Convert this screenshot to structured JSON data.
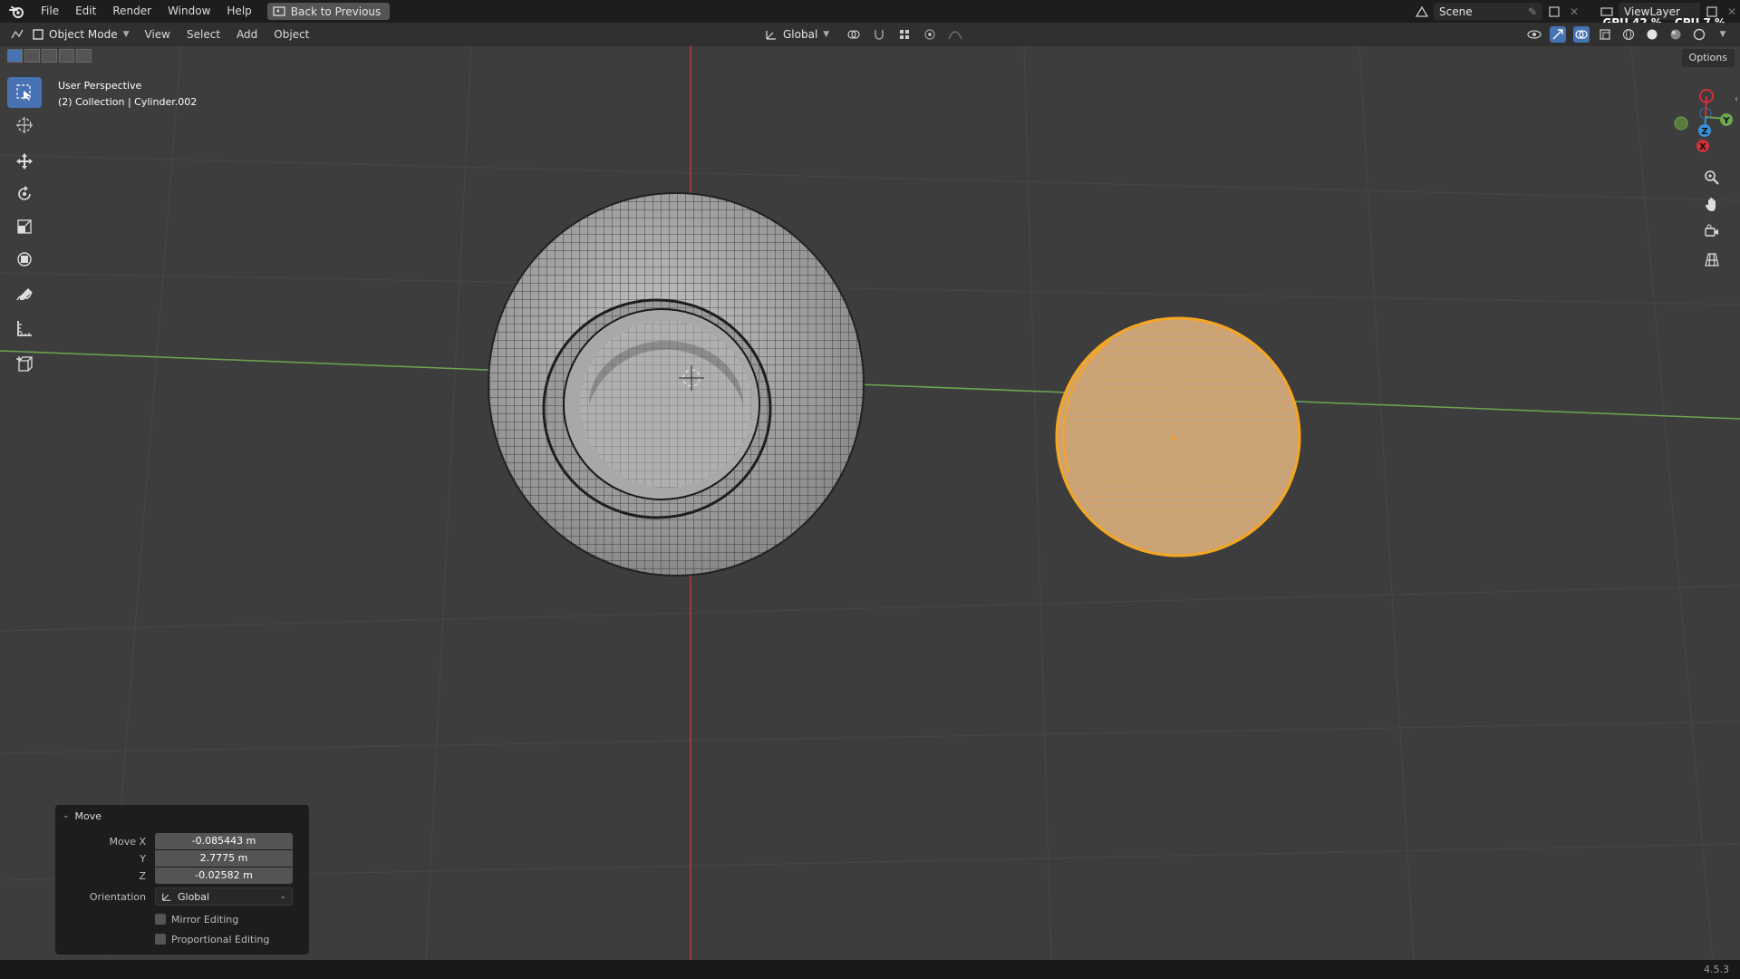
{
  "menu": {
    "items": [
      "File",
      "Edit",
      "Render",
      "Window",
      "Help"
    ],
    "back_label": "Back to Previous"
  },
  "topright": {
    "scene": "Scene",
    "viewlayer": "ViewLayer",
    "gpu": "GPU 42 %",
    "cpu": "CPU 7 %"
  },
  "header": {
    "mode": "Object Mode",
    "items": [
      "View",
      "Select",
      "Add",
      "Object"
    ],
    "orientation": "Global"
  },
  "viewport": {
    "options_label": "Options",
    "perspective": "User Perspective",
    "collection": "(2) Collection | Cylinder.002"
  },
  "gizmo": {
    "y_label": "Y",
    "z_label": "Z",
    "x_label": "X"
  },
  "move_panel": {
    "title": "Move",
    "move_x_label": "Move X",
    "move_x": "-0.085443 m",
    "y_label": "Y",
    "y": "2.7775 m",
    "z_label": "Z",
    "z": "-0.02582 m",
    "orientation_label": "Orientation",
    "orientation": "Global",
    "mirror_label": "Mirror Editing",
    "proportional_label": "Proportional Editing"
  },
  "status": {
    "version": "4.5.3"
  },
  "colors": {
    "accent": "#4772b3",
    "selected_object": "#f5a623",
    "x_axis": "#d0303a",
    "y_axis": "#6aa84f",
    "z_axis": "#3a8fd9"
  }
}
